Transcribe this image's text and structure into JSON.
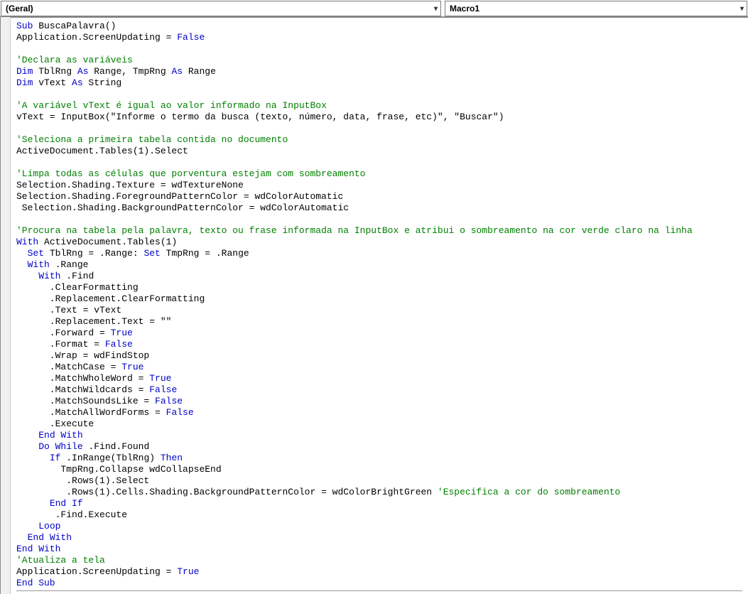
{
  "dropdowns": {
    "left": "(Geral)",
    "right": "Macro1"
  },
  "code": {
    "tokens": [
      [
        [
          "kw",
          "Sub"
        ],
        [
          "",
          " BuscaPalavra()"
        ]
      ],
      [
        [
          "",
          "Application.ScreenUpdating = "
        ],
        [
          "kw",
          "False"
        ]
      ],
      [],
      [
        [
          "cm",
          "'Declara as variáveis"
        ]
      ],
      [
        [
          "kw",
          "Dim"
        ],
        [
          "",
          " TblRng "
        ],
        [
          "kw",
          "As"
        ],
        [
          "",
          " Range, TmpRng "
        ],
        [
          "kw",
          "As"
        ],
        [
          "",
          " Range"
        ]
      ],
      [
        [
          "kw",
          "Dim"
        ],
        [
          "",
          " vText "
        ],
        [
          "kw",
          "As"
        ],
        [
          "",
          " String"
        ]
      ],
      [],
      [
        [
          "cm",
          "'A variável vText é igual ao valor informado na InputBox"
        ]
      ],
      [
        [
          "",
          "vText = InputBox(\"Informe o termo da busca (texto, número, data, frase, etc)\", \"Buscar\")"
        ]
      ],
      [],
      [
        [
          "cm",
          "'Seleciona a primeira tabela contida no documento"
        ]
      ],
      [
        [
          "",
          "ActiveDocument.Tables(1).Select"
        ]
      ],
      [],
      [
        [
          "cm",
          "'Limpa todas as células que porventura estejam com sombreamento"
        ]
      ],
      [
        [
          "",
          "Selection.Shading.Texture = wdTextureNone"
        ]
      ],
      [
        [
          "",
          "Selection.Shading.ForegroundPatternColor = wdColorAutomatic"
        ]
      ],
      [
        [
          "",
          " Selection.Shading.BackgroundPatternColor = wdColorAutomatic"
        ]
      ],
      [],
      [
        [
          "cm",
          "'Procura na tabela pela palavra, texto ou frase informada na InputBox e atribui o sombreamento na cor verde claro na linha"
        ]
      ],
      [
        [
          "kw",
          "With"
        ],
        [
          "",
          " ActiveDocument.Tables(1)"
        ]
      ],
      [
        [
          "",
          "  "
        ],
        [
          "kw",
          "Set"
        ],
        [
          "",
          " TblRng = .Range: "
        ],
        [
          "kw",
          "Set"
        ],
        [
          "",
          " TmpRng = .Range"
        ]
      ],
      [
        [
          "",
          "  "
        ],
        [
          "kw",
          "With"
        ],
        [
          "",
          " .Range"
        ]
      ],
      [
        [
          "",
          "    "
        ],
        [
          "kw",
          "With"
        ],
        [
          "",
          " .Find"
        ]
      ],
      [
        [
          "",
          "      .ClearFormatting"
        ]
      ],
      [
        [
          "",
          "      .Replacement.ClearFormatting"
        ]
      ],
      [
        [
          "",
          "      .Text = vText"
        ]
      ],
      [
        [
          "",
          "      .Replacement.Text = \"\""
        ]
      ],
      [
        [
          "",
          "      .Forward = "
        ],
        [
          "kw",
          "True"
        ]
      ],
      [
        [
          "",
          "      .Format = "
        ],
        [
          "kw",
          "False"
        ]
      ],
      [
        [
          "",
          "      .Wrap = wdFindStop"
        ]
      ],
      [
        [
          "",
          "      .MatchCase = "
        ],
        [
          "kw",
          "True"
        ]
      ],
      [
        [
          "",
          "      .MatchWholeWord = "
        ],
        [
          "kw",
          "True"
        ]
      ],
      [
        [
          "",
          "      .MatchWildcards = "
        ],
        [
          "kw",
          "False"
        ]
      ],
      [
        [
          "",
          "      .MatchSoundsLike = "
        ],
        [
          "kw",
          "False"
        ]
      ],
      [
        [
          "",
          "      .MatchAllWordForms = "
        ],
        [
          "kw",
          "False"
        ]
      ],
      [
        [
          "",
          "      .Execute"
        ]
      ],
      [
        [
          "",
          "    "
        ],
        [
          "kw",
          "End With"
        ]
      ],
      [
        [
          "",
          "    "
        ],
        [
          "kw",
          "Do While"
        ],
        [
          "",
          " .Find.Found"
        ]
      ],
      [
        [
          "",
          "      "
        ],
        [
          "kw",
          "If"
        ],
        [
          "",
          " .InRange(TblRng) "
        ],
        [
          "kw",
          "Then"
        ]
      ],
      [
        [
          "",
          "        TmpRng.Collapse wdCollapseEnd"
        ]
      ],
      [
        [
          "",
          "         .Rows(1).Select"
        ]
      ],
      [
        [
          "",
          "         .Rows(1).Cells.Shading.BackgroundPatternColor = wdColorBrightGreen "
        ],
        [
          "cm",
          "'Especifica a cor do sombreamento"
        ]
      ],
      [
        [
          "",
          "      "
        ],
        [
          "kw",
          "End If"
        ]
      ],
      [
        [
          "",
          "       .Find.Execute"
        ]
      ],
      [
        [
          "",
          "    "
        ],
        [
          "kw",
          "Loop"
        ]
      ],
      [
        [
          "",
          "  "
        ],
        [
          "kw",
          "End With"
        ]
      ],
      [
        [
          "kw",
          "End With"
        ]
      ],
      [
        [
          "cm",
          "'Atualiza a tela"
        ]
      ],
      [
        [
          "",
          "Application.ScreenUpdating = "
        ],
        [
          "kw",
          "True"
        ]
      ],
      [
        [
          "kw",
          "End Sub"
        ]
      ]
    ]
  }
}
